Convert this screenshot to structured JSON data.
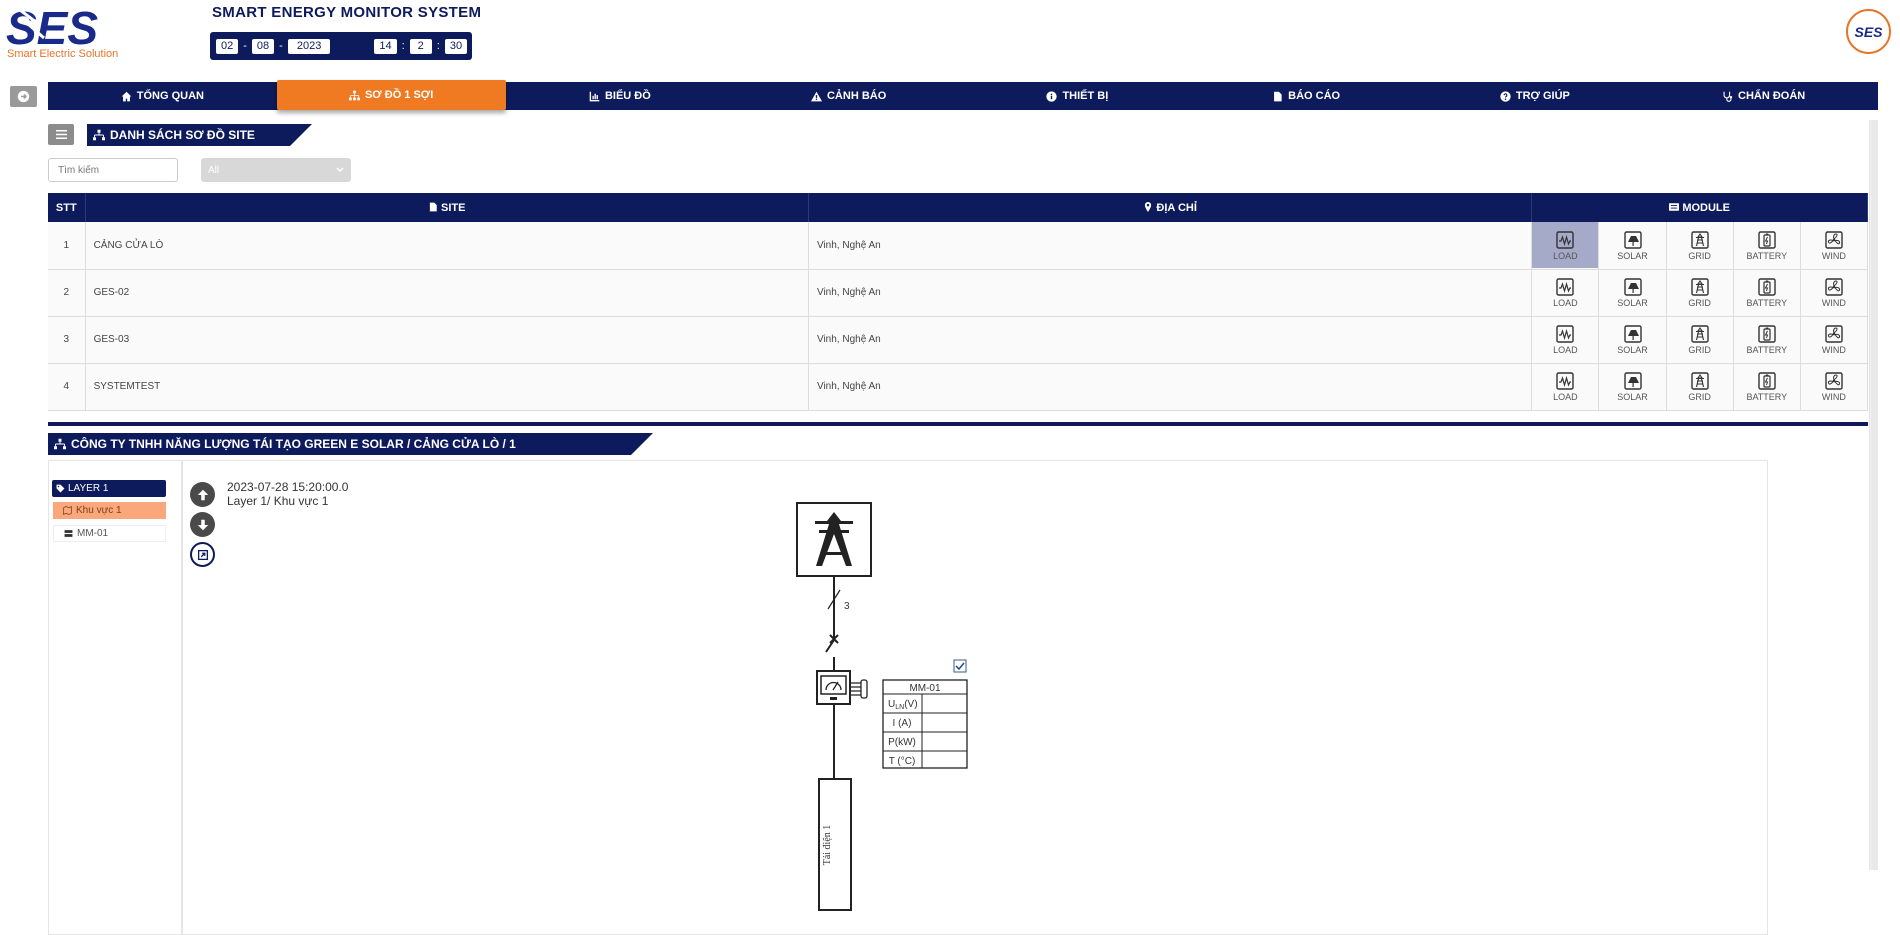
{
  "header": {
    "logo_text": "SES",
    "logo_tagline": "Smart Electric Solution",
    "system_title": "SMART ENERGY MONITOR SYSTEM",
    "clock": {
      "day": "02",
      "month": "08",
      "year": "2023",
      "hour": "14",
      "minute": "2",
      "second": "30",
      "date_sep": "-",
      "time_sep": ":"
    },
    "brand_badge_text": "SES"
  },
  "nav": {
    "items": [
      {
        "label": "TỔNG QUAN",
        "icon": "home-icon"
      },
      {
        "label": "SƠ ĐỒ 1 SỢI",
        "icon": "sitemap-icon",
        "active": true
      },
      {
        "label": "BIỂU ĐỒ",
        "icon": "bar-chart-icon"
      },
      {
        "label": "CẢNH BÁO",
        "icon": "warning-icon"
      },
      {
        "label": "THIẾT BỊ",
        "icon": "info-icon"
      },
      {
        "label": "BÁO CÁO",
        "icon": "document-icon"
      },
      {
        "label": "TRỢ GIÚP",
        "icon": "help-icon"
      },
      {
        "label": "CHẨN ĐOÁN",
        "icon": "stethoscope-icon"
      }
    ]
  },
  "site_list": {
    "title": "DANH SÁCH SƠ ĐỒ SITE",
    "search_placeholder": "Tìm kiếm",
    "filter_value": "All",
    "headers": {
      "stt": "STT",
      "site": "SITE",
      "address": "ĐỊA CHỈ",
      "module": "MODULE"
    },
    "modules": [
      "LOAD",
      "SOLAR",
      "GRID",
      "BATTERY",
      "WIND"
    ],
    "rows": [
      {
        "stt": "1",
        "site": "CẢNG CỬA LÒ",
        "address": "Vinh, Nghệ An"
      },
      {
        "stt": "2",
        "site": "GES-02",
        "address": "Vinh, Nghệ An"
      },
      {
        "stt": "3",
        "site": "GES-03",
        "address": "Vinh, Nghệ An"
      },
      {
        "stt": "4",
        "site": "SYSTEMTEST",
        "address": "Vinh, Nghệ An"
      }
    ]
  },
  "diagram": {
    "breadcrumb": "CÔNG TY TNHH NĂNG LƯỢNG TÁI TẠO GREEN E SOLAR / CẢNG CỬA LÒ / 1",
    "layers": {
      "layer": "LAYER 1",
      "area": "Khu vực 1",
      "meter": "MM-01"
    },
    "timestamp": "2023-07-28 15:20:00.0",
    "location": "Layer 1/ Khu vực 1",
    "phase_count": "3",
    "meter_name": "MM-01",
    "meter_rows": [
      "U",
      "I (A)",
      "P(kW)",
      "T (°C)"
    ],
    "meter_u_sub": "LN",
    "meter_u_unit": "(V)",
    "load_label": "Tải điện 1"
  },
  "colors": {
    "navy": "#0d1b5c",
    "orange": "#f07a22",
    "highlight": "#a4aac8"
  }
}
